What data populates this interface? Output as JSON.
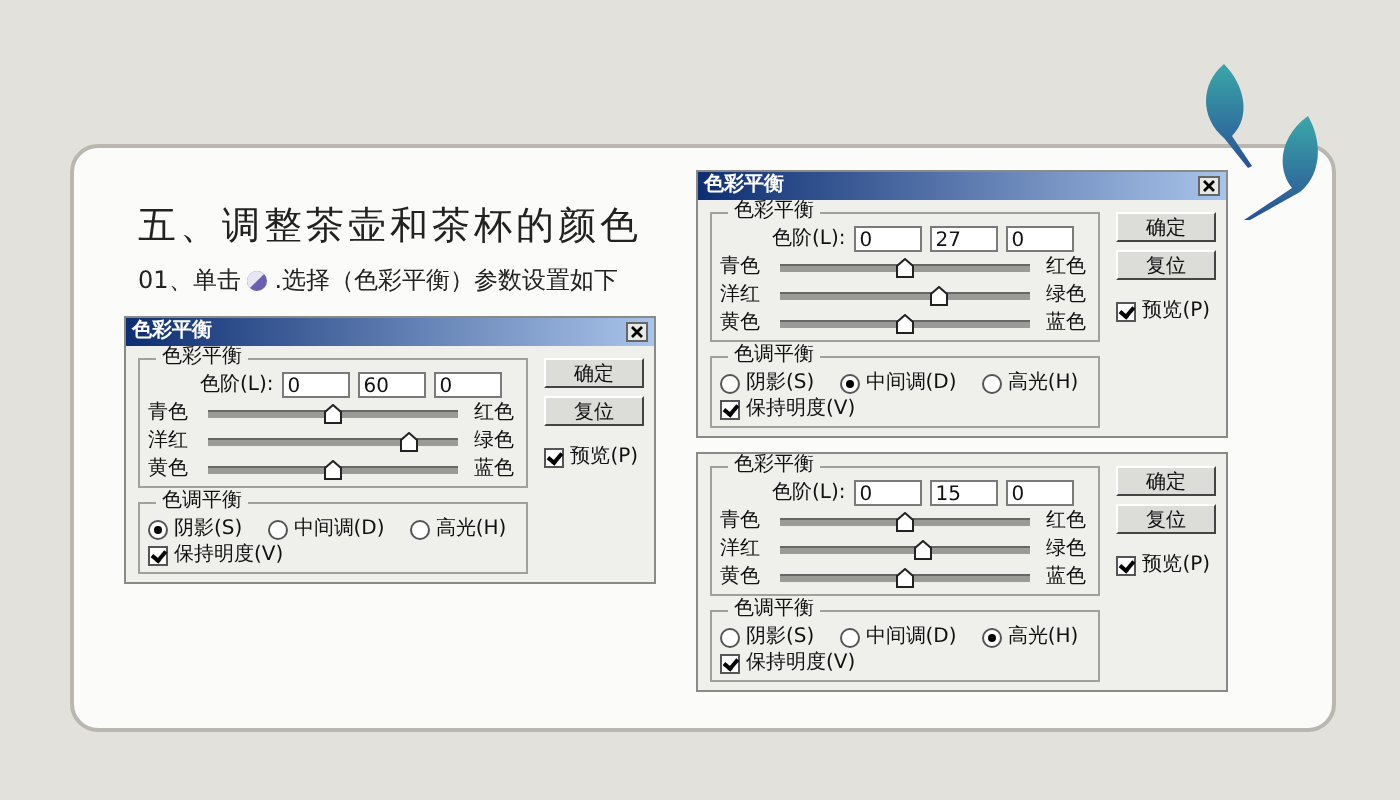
{
  "header": {
    "title": "五、调整茶壶和茶杯的颜色",
    "step_prefix": "01、单击",
    "step_text": ".选择（色彩平衡）参数设置如下"
  },
  "dialogs": [
    {
      "title": "色彩平衡",
      "balance_group": "色彩平衡",
      "levels_label": "色阶(L):",
      "levels": [
        "0",
        "60",
        "0"
      ],
      "sliders": [
        {
          "left": "青色",
          "right": "红色",
          "level": 0.5
        },
        {
          "left": "洋红",
          "right": "绿色",
          "level": 0.8
        },
        {
          "left": "黄色",
          "right": "蓝色",
          "level": 0.5
        }
      ],
      "tone_group": "色调平衡",
      "tones": [
        {
          "label": "阴影(S)",
          "selected": true
        },
        {
          "label": "中间调(D)",
          "selected": false
        },
        {
          "label": "高光(H)",
          "selected": false
        }
      ],
      "preserve": {
        "label": "保持明度(V)",
        "checked": true
      },
      "buttons": [
        "确定",
        "复位"
      ],
      "preview": {
        "label": "预览(P)",
        "checked": true
      }
    },
    {
      "title": "色彩平衡",
      "balance_group": "色彩平衡",
      "levels_label": "色阶(L):",
      "levels": [
        "0",
        "27",
        "0"
      ],
      "sliders": [
        {
          "left": "青色",
          "right": "红色",
          "level": 0.5
        },
        {
          "left": "洋红",
          "right": "绿色",
          "level": 0.635
        },
        {
          "left": "黄色",
          "right": "蓝色",
          "level": 0.5
        }
      ],
      "tone_group": "色调平衡",
      "tones": [
        {
          "label": "阴影(S)",
          "selected": false
        },
        {
          "label": "中间调(D)",
          "selected": true
        },
        {
          "label": "高光(H)",
          "selected": false
        }
      ],
      "preserve": {
        "label": "保持明度(V)",
        "checked": true
      },
      "buttons": [
        "确定",
        "复位"
      ],
      "preview": {
        "label": "预览(P)",
        "checked": true
      }
    },
    {
      "balance_group": "色彩平衡",
      "levels_label": "色阶(L):",
      "levels": [
        "0",
        "15",
        "0"
      ],
      "sliders": [
        {
          "left": "青色",
          "right": "红色",
          "level": 0.5
        },
        {
          "left": "洋红",
          "right": "绿色",
          "level": 0.575
        },
        {
          "left": "黄色",
          "right": "蓝色",
          "level": 0.5
        }
      ],
      "tone_group": "色调平衡",
      "tones": [
        {
          "label": "阴影(S)",
          "selected": false
        },
        {
          "label": "中间调(D)",
          "selected": false
        },
        {
          "label": "高光(H)",
          "selected": true
        }
      ],
      "preserve": {
        "label": "保持明度(V)",
        "checked": true
      },
      "buttons": [
        "确定",
        "复位"
      ],
      "preview": {
        "label": "预览(P)",
        "checked": true
      }
    }
  ]
}
